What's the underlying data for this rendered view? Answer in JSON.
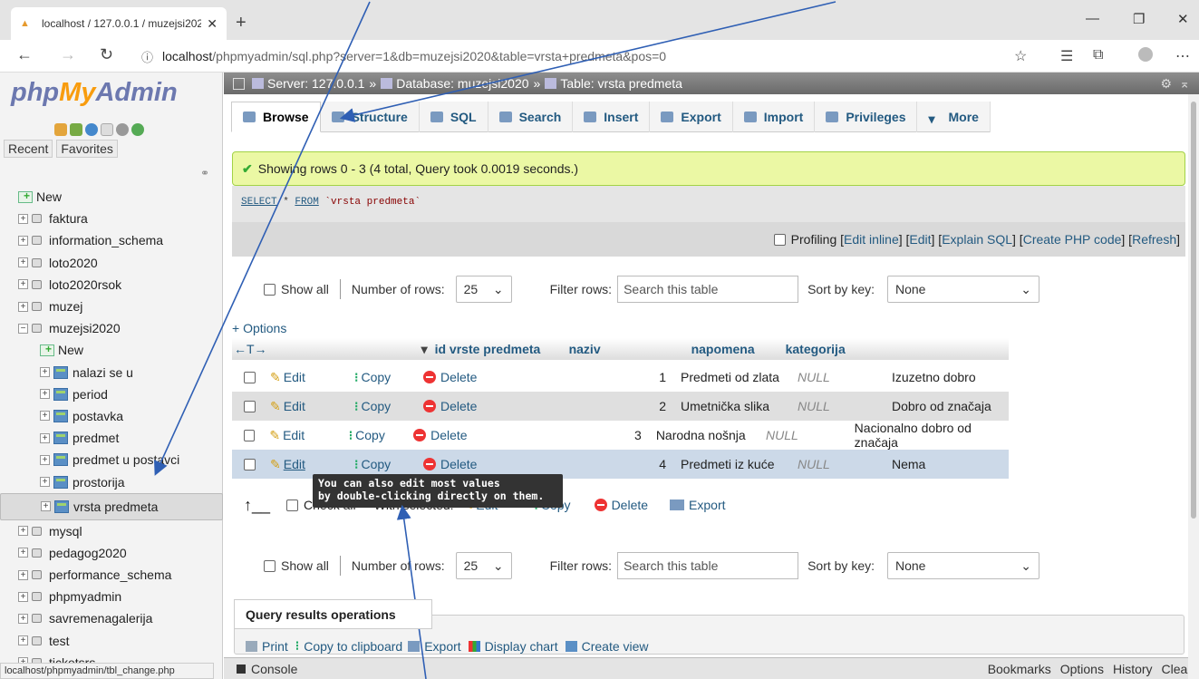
{
  "browser": {
    "tab_title": "localhost / 127.0.0.1 / muzejsi202",
    "new_tab": "+",
    "url_host": "localhost",
    "url_path": "/phpmyadmin/sql.php?server=1&db=muzejsi2020&table=vrsta+predmeta&pos=0",
    "status_url": "localhost/phpmyadmin/tbl_change.php"
  },
  "sidebar": {
    "logo_php": "php",
    "logo_my": "My",
    "logo_admin": "Admin",
    "recent": "Recent",
    "favorites": "Favorites",
    "tree": [
      {
        "label": "New",
        "type": "new",
        "indent": 0
      },
      {
        "label": "faktura",
        "type": "db",
        "indent": 0
      },
      {
        "label": "information_schema",
        "type": "db",
        "indent": 0
      },
      {
        "label": "loto2020",
        "type": "db",
        "indent": 0
      },
      {
        "label": "loto2020rsok",
        "type": "db",
        "indent": 0
      },
      {
        "label": "muzej",
        "type": "db",
        "indent": 0
      },
      {
        "label": "muzejsi2020",
        "type": "db-open",
        "indent": 0
      },
      {
        "label": "New",
        "type": "new",
        "indent": 1
      },
      {
        "label": "nalazi se u",
        "type": "table",
        "indent": 1
      },
      {
        "label": "period",
        "type": "table",
        "indent": 1
      },
      {
        "label": "postavka",
        "type": "table",
        "indent": 1
      },
      {
        "label": "predmet",
        "type": "table",
        "indent": 1
      },
      {
        "label": "predmet u postavci",
        "type": "table",
        "indent": 1
      },
      {
        "label": "prostorija",
        "type": "table",
        "indent": 1
      },
      {
        "label": "vrsta predmeta",
        "type": "table",
        "indent": 1,
        "selected": true
      },
      {
        "label": "mysql",
        "type": "db",
        "indent": 0
      },
      {
        "label": "pedagog2020",
        "type": "db",
        "indent": 0
      },
      {
        "label": "performance_schema",
        "type": "db",
        "indent": 0
      },
      {
        "label": "phpmyadmin",
        "type": "db",
        "indent": 0
      },
      {
        "label": "savremenagalerija",
        "type": "db",
        "indent": 0
      },
      {
        "label": "test",
        "type": "db",
        "indent": 0
      },
      {
        "label": "ticketsrs",
        "type": "db",
        "indent": 0
      }
    ]
  },
  "breadcrumb": {
    "server": "Server: 127.0.0.1",
    "sep": "»",
    "database": "Database: muzejsi2020",
    "table": "Table: vrsta predmeta"
  },
  "tabs": [
    "Browse",
    "Structure",
    "SQL",
    "Search",
    "Insert",
    "Export",
    "Import",
    "Privileges",
    "More"
  ],
  "success": "Showing rows 0 - 3 (4 total, Query took 0.0019 seconds.)",
  "sql": {
    "kw1": "SELECT",
    "mid": " * ",
    "kw2": "FROM",
    "table": " `vrsta predmeta`"
  },
  "profiling": {
    "label": "Profiling",
    "edit_inline": "Edit inline",
    "edit": "Edit",
    "explain": "Explain SQL",
    "php": "Create PHP code",
    "refresh": "Refresh"
  },
  "controls": {
    "show_all": "Show all",
    "num_rows_label": "Number of rows:",
    "num_rows": "25",
    "filter_label": "Filter rows:",
    "filter_placeholder": "Search this table",
    "sort_label": "Sort by key:",
    "sort_value": "None"
  },
  "options": "+ Options",
  "columns": [
    "id vrste predmeta",
    "naziv",
    "napomena",
    "kategorija"
  ],
  "actions": {
    "edit": "Edit",
    "copy": "Copy",
    "delete": "Delete"
  },
  "rows": [
    {
      "id": "1",
      "naziv": "Predmeti od zlata",
      "napomena": "NULL",
      "kategorija": "Izuzetno dobro"
    },
    {
      "id": "2",
      "naziv": "Umetnička slika",
      "napomena": "NULL",
      "kategorija": "Dobro od značaja"
    },
    {
      "id": "3",
      "naziv": "Narodna nošnja",
      "napomena": "NULL",
      "kategorija": "Nacionalno dobro od značaja"
    },
    {
      "id": "4",
      "naziv": "Predmeti iz kuće",
      "napomena": "NULL",
      "kategorija": "Nema"
    }
  ],
  "tooltip": {
    "line1": "You can also edit most values",
    "line2": "by double-clicking directly on them."
  },
  "with_selected": {
    "check_all": "Check all",
    "with_sel": "With selected:",
    "edit": "Edit",
    "copy": "Copy",
    "delete": "Delete",
    "export": "Export"
  },
  "qro": {
    "title": "Query results operations",
    "print": "Print",
    "copy": "Copy to clipboard",
    "export": "Export",
    "chart": "Display chart",
    "view": "Create view"
  },
  "console": {
    "label": "Console",
    "bookmarks": "Bookmarks",
    "options": "Options",
    "history": "History",
    "clear": "Clear"
  },
  "colors": {
    "link": "#235a81",
    "success_bg": "#ebf8a4",
    "highlight_row": "#ccd9e8",
    "arrow": "#2f5fb4"
  }
}
